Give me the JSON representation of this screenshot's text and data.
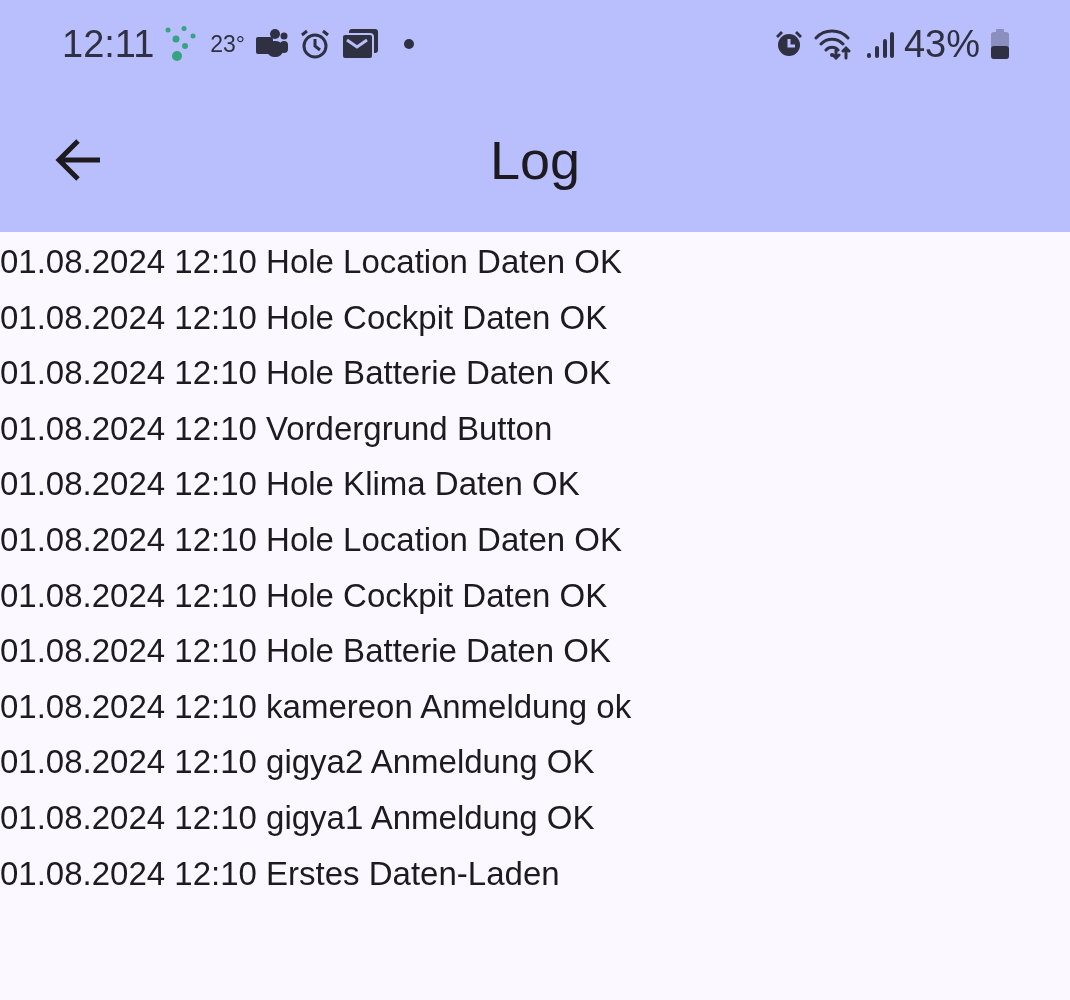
{
  "status_bar": {
    "time": "12:11",
    "temperature": "23°",
    "battery_percent": "43%"
  },
  "app_bar": {
    "title": "Log"
  },
  "log_entries": [
    "01.08.2024 12:10 Hole Location Daten OK",
    "01.08.2024 12:10 Hole Cockpit Daten OK",
    "01.08.2024 12:10 Hole Batterie Daten OK",
    "01.08.2024 12:10 Vordergrund Button",
    "01.08.2024 12:10 Hole Klima Daten OK",
    "01.08.2024 12:10 Hole Location Daten OK",
    "01.08.2024 12:10 Hole Cockpit Daten OK",
    "01.08.2024 12:10 Hole Batterie Daten OK",
    "01.08.2024 12:10 kamereon Anmeldung ok",
    "01.08.2024 12:10 gigya2 Anmeldung OK",
    "01.08.2024 12:10 gigya1 Anmeldung OK",
    "01.08.2024 12:10 Erstes Daten-Laden"
  ]
}
